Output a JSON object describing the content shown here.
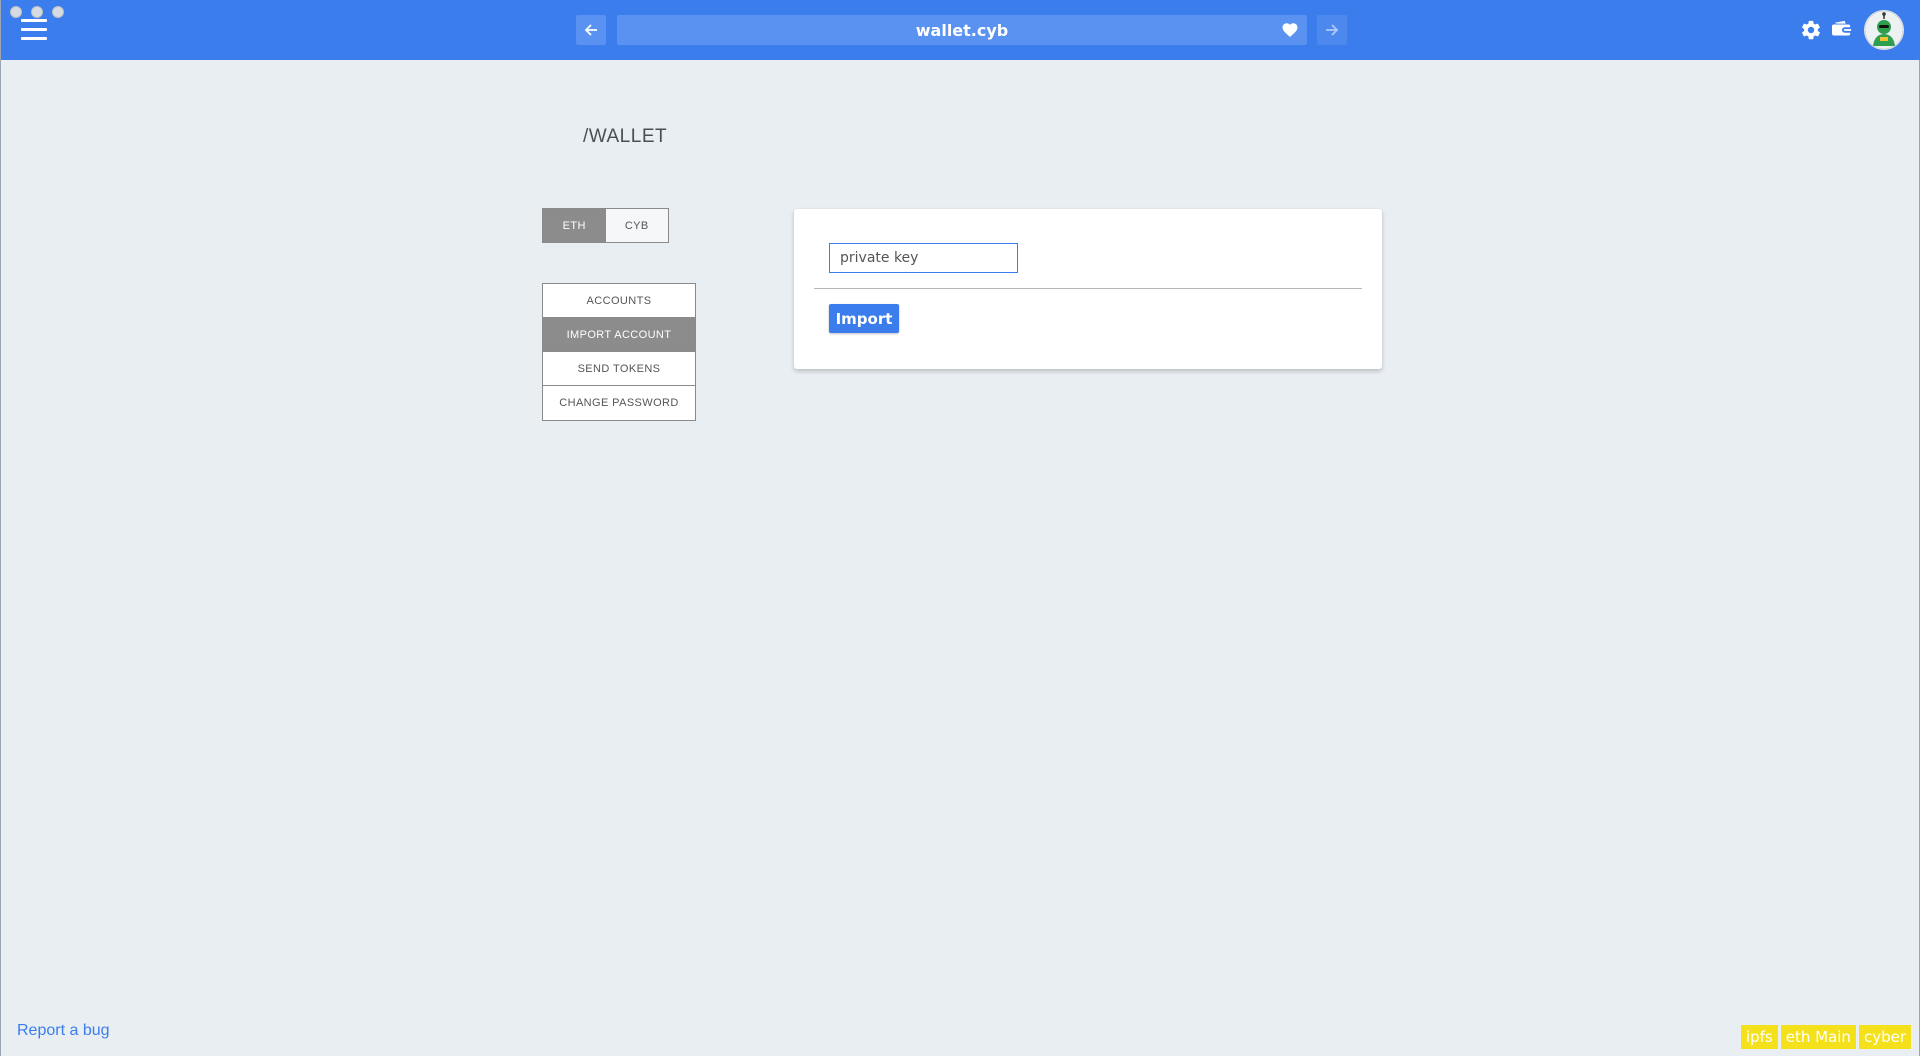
{
  "browser": {
    "address": "wallet.cyb",
    "icons": {
      "menu": "hamburger-menu-icon",
      "back": "arrow-left-icon",
      "forward": "arrow-right-icon",
      "favorite": "heart-icon",
      "settings": "gear-icon",
      "wallet": "wallet-icon",
      "avatar": "robot-avatar"
    },
    "accent": "#3b7ded"
  },
  "page": {
    "title": "/WALLET"
  },
  "network_tabs": [
    {
      "label": "ETH",
      "active": true
    },
    {
      "label": "CYB",
      "active": false
    }
  ],
  "side_menu": [
    {
      "label": "ACCOUNTS",
      "active": false
    },
    {
      "label": "IMPORT ACCOUNT",
      "active": true
    },
    {
      "label": "SEND TOKENS",
      "active": false
    },
    {
      "label": "CHANGE PASSWORD",
      "active": false
    }
  ],
  "import_form": {
    "input_placeholder": "private key",
    "input_value": "",
    "button_label": "Import"
  },
  "footer": {
    "report_link": "Report a bug",
    "status_badges": [
      "ipfs",
      "eth Main",
      "cyber"
    ],
    "badge_color": "#f5e11b"
  }
}
